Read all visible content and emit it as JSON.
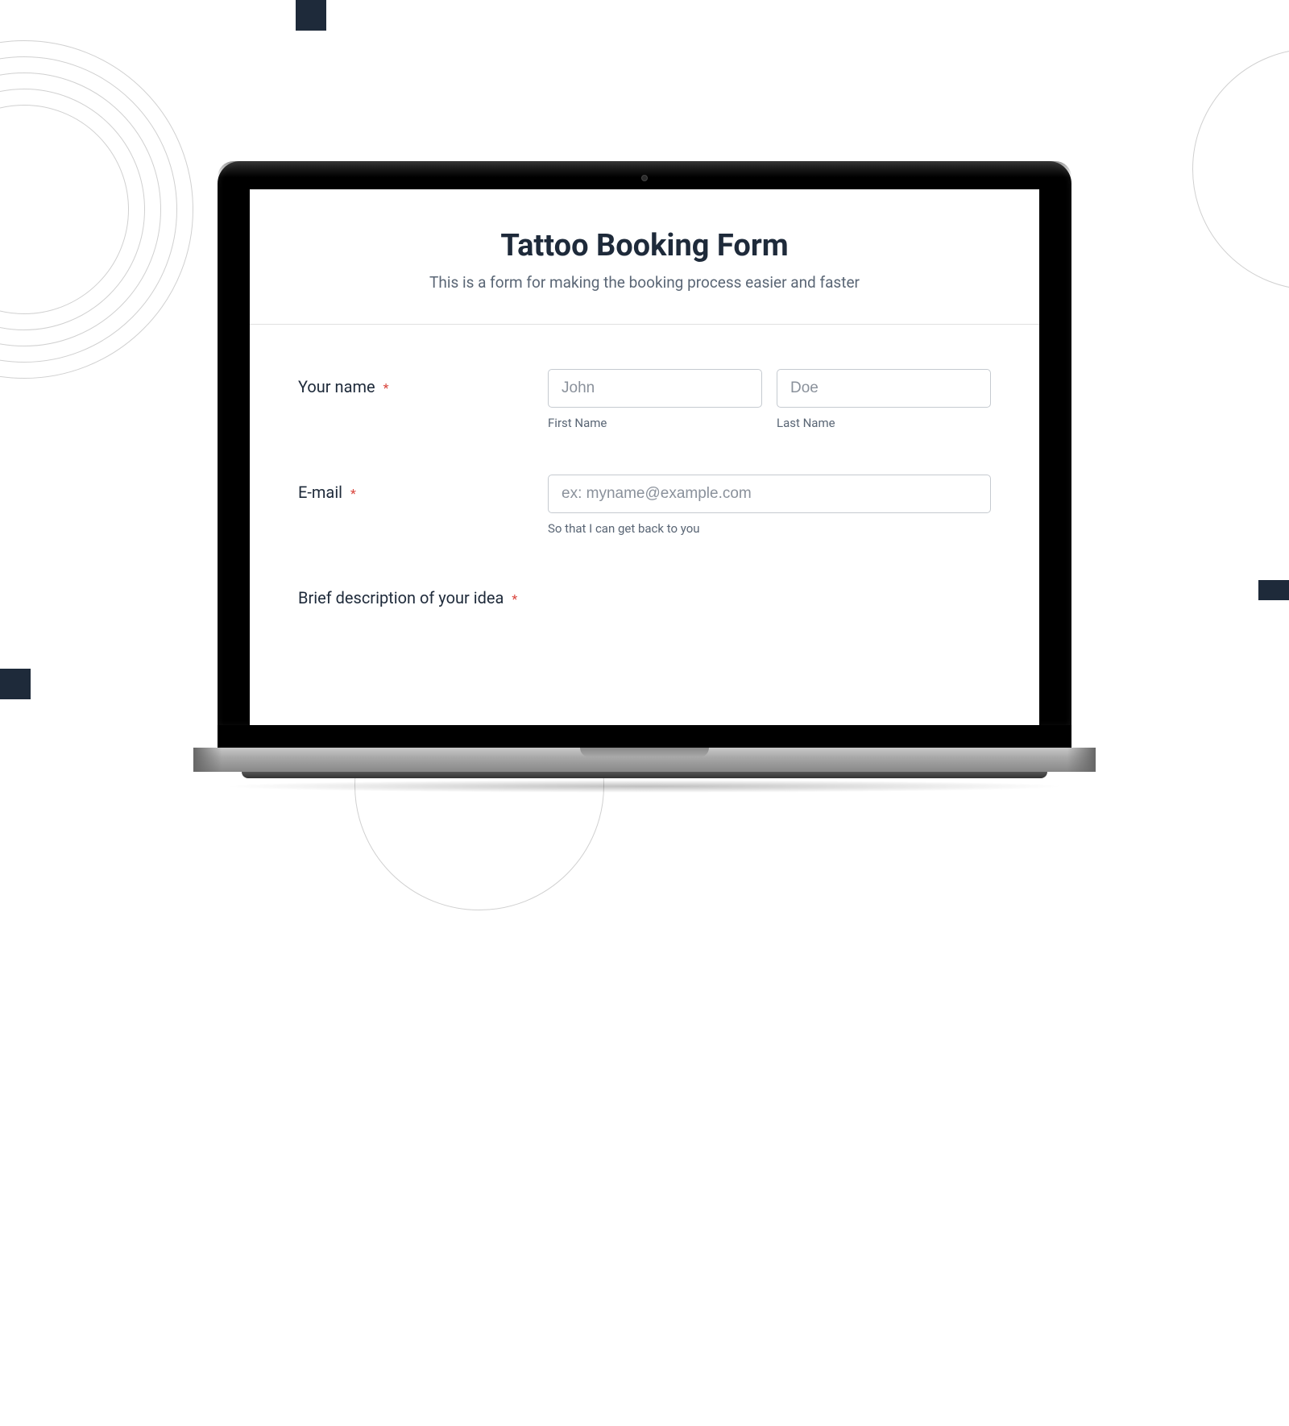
{
  "form": {
    "title": "Tattoo Booking Form",
    "subtitle": "This is a form for making the booking process easier and faster",
    "fields": {
      "name": {
        "label": "Your name",
        "required": "*",
        "first_placeholder": "John",
        "first_sublabel": "First Name",
        "last_placeholder": "Doe",
        "last_sublabel": "Last Name"
      },
      "email": {
        "label": "E-mail",
        "required": "*",
        "placeholder": "ex: myname@example.com",
        "sublabel": "So that I can get back to you"
      },
      "description": {
        "label": "Brief description of your idea",
        "required": "*"
      }
    }
  }
}
